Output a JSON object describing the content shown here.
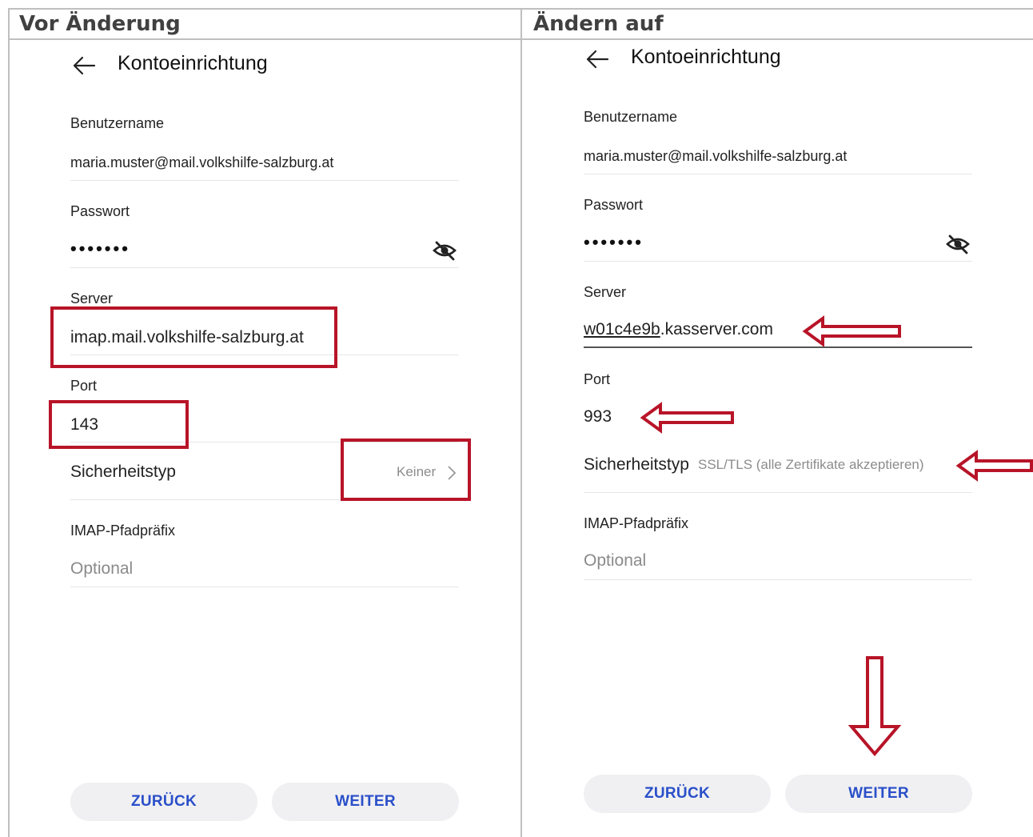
{
  "header": {
    "left_title": "Vor Änderung",
    "right_title": "Ändern auf"
  },
  "before": {
    "screen_title": "Kontoeinrichtung",
    "username_label": "Benutzername",
    "username_value": "maria.muster@mail.volkshilfe-salzburg.at",
    "password_label": "Passwort",
    "password_value": "•••••••",
    "server_label": "Server",
    "server_value": "imap.mail.volkshilfe-salzburg.at",
    "port_label": "Port",
    "port_value": "143",
    "security_label": "Sicherheitstyp",
    "security_value": "Keiner",
    "imap_label": "IMAP-Pfadpräfix",
    "imap_placeholder": "Optional",
    "back_button": "ZURÜCK",
    "next_button": "WEITER"
  },
  "after": {
    "screen_title": "Kontoeinrichtung",
    "username_label": "Benutzername",
    "username_value": "maria.muster@mail.volkshilfe-salzburg.at",
    "password_label": "Passwort",
    "password_value": "•••••••",
    "server_label": "Server",
    "server_value_part1": "w01c4e9b",
    "server_value_part2": ".kasserver.com",
    "port_label": "Port",
    "port_value": "993",
    "security_label": "Sicherheitstyp",
    "security_value": "SSL/TLS (alle Zertifikate akzeptieren)",
    "imap_label": "IMAP-Pfadpräfix",
    "imap_placeholder": "Optional",
    "back_button": "ZURÜCK",
    "next_button": "WEITER"
  },
  "colors": {
    "highlight_red": "#b81428",
    "button_text_blue": "#2a4fc9",
    "button_bg": "#f0f0f2"
  },
  "icons": {
    "back": "back-arrow-icon",
    "password_visibility": "eye-off-icon",
    "chevron": "chevron-right-icon",
    "annotation_arrow": "outline-arrow-icon"
  }
}
